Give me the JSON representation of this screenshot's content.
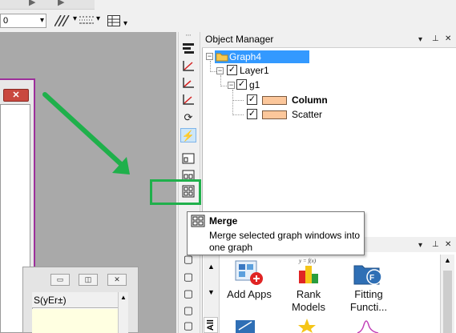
{
  "toolbar": {
    "size_value": "0",
    "arrow_down": "▾"
  },
  "graph_window": {
    "close_label": "✕"
  },
  "worksheet": {
    "minimize": "▭",
    "restore": "◫",
    "close": "✕",
    "column_header": "S(yEr±)"
  },
  "object_manager": {
    "title": "Object Manager",
    "pane_controls": [
      "▾",
      "⊥",
      "✕"
    ],
    "tree": {
      "root": "Graph4",
      "layer": "Layer1",
      "group": "g1",
      "plots": [
        {
          "label": "Column",
          "bold": true
        },
        {
          "label": "Scatter",
          "bold": false
        }
      ]
    }
  },
  "tooltip": {
    "title": "Merge",
    "description": "Merge selected graph windows into one graph"
  },
  "apps": {
    "pane_controls": [
      "▾",
      "⊥",
      "✕"
    ],
    "side_tab": "All",
    "items": [
      {
        "line1": "Add Apps",
        "line2": ""
      },
      {
        "line1": "Rank",
        "line2": "Models"
      },
      {
        "line1": "Fitting",
        "line2": "Functi..."
      }
    ]
  },
  "colors": {
    "highlight": "#1fb04b",
    "arrow": "#1fb04b",
    "plot_swatch": "#fcc79b",
    "selected_node": "#3399ff",
    "graph_border": "#9d2f9b"
  }
}
